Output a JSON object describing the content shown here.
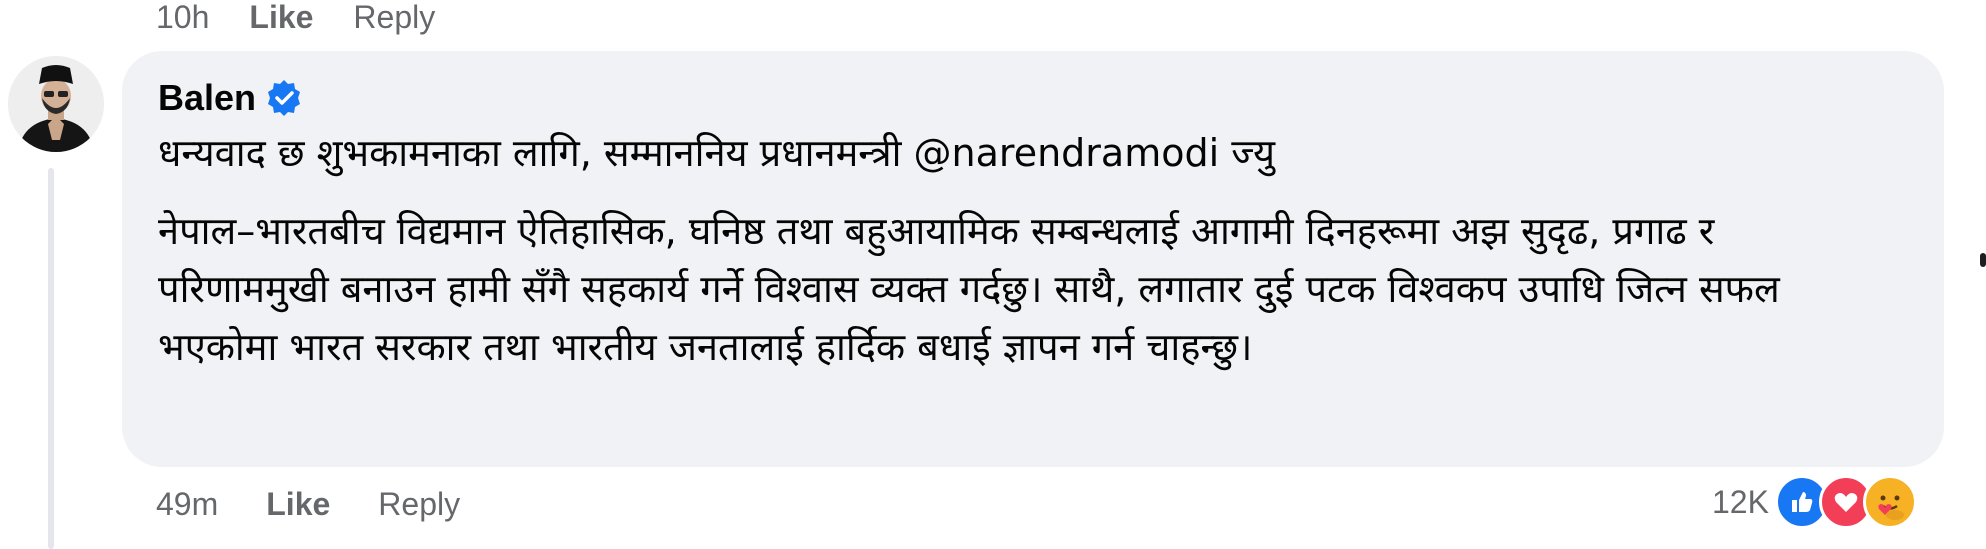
{
  "previous_comment": {
    "time": "10h",
    "like_label": "Like",
    "reply_label": "Reply"
  },
  "comment": {
    "author": "Balen",
    "verified": true,
    "paragraph_1": "धन्यवाद छ शुभकामनाका लागि, सम्माननिय प्रधानमन्त्री @narendramodi ज्यु",
    "paragraph_2": "नेपाल–भारतबीच विद्यमान ऐतिहासिक, घनिष्ठ तथा बहुआयामिक सम्बन्धलाई आगामी दिनहरूमा अझ सुदृढ, प्रगाढ र परिणाममुखी बनाउन हामी सँगै सहकार्य गर्ने विश्वास व्यक्त गर्दछु। साथै, लगातार दुई पटक विश्वकप उपाधि जित्न सफल भएकोमा भारत सरकार तथा भारतीय जनतालाई हार्दिक बधाई ज्ञापन गर्न चाहन्छु।",
    "time": "49m",
    "like_label": "Like",
    "reply_label": "Reply",
    "reaction_count": "12K",
    "reactions": [
      "like-icon",
      "love-icon",
      "care-icon"
    ]
  },
  "colors": {
    "bubble": "#f0f2f5",
    "secondary_text": "#65676b",
    "verified_blue": "#1877f2",
    "love_red": "#f33e58",
    "care_yellow": "#f7b125"
  }
}
